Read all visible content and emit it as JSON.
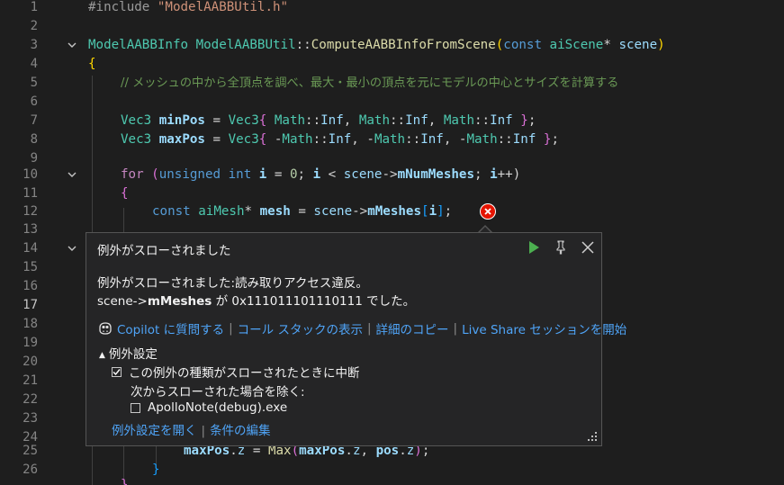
{
  "editor": {
    "active_line": 17,
    "lines": [
      {
        "n": "1"
      },
      {
        "n": "2"
      },
      {
        "n": "3"
      },
      {
        "n": "4"
      },
      {
        "n": "5"
      },
      {
        "n": "6"
      },
      {
        "n": "7"
      },
      {
        "n": "8"
      },
      {
        "n": "9"
      },
      {
        "n": "10"
      },
      {
        "n": "11"
      },
      {
        "n": "12"
      },
      {
        "n": "13"
      },
      {
        "n": "14"
      },
      {
        "n": "15"
      },
      {
        "n": "16"
      },
      {
        "n": "17"
      },
      {
        "n": "18"
      },
      {
        "n": "19"
      },
      {
        "n": "20"
      },
      {
        "n": "21"
      },
      {
        "n": "22"
      },
      {
        "n": "23"
      },
      {
        "n": "24"
      },
      {
        "n": "25"
      },
      {
        "n": "26"
      }
    ],
    "code": {
      "l1": [
        "#include ",
        "\"ModelAABBUtil.h\""
      ],
      "l3": [
        "ModelAABBInfo",
        " ",
        "ModelAABBUtil",
        "::",
        "ComputeAABBInfoFromScene",
        "(",
        "const",
        " ",
        "aiScene",
        "* ",
        "scene",
        ")"
      ],
      "l4": [
        "{"
      ],
      "l5": [
        "// メッシュの中から全頂点を調べ、最大・最小の頂点を元にモデルの中心とサイズを計算する"
      ],
      "l7": [
        "Vec3",
        " ",
        "minPos",
        " = ",
        "Vec3",
        "{ ",
        "Math",
        "::",
        "Inf",
        ", ",
        "Math",
        "::",
        "Inf",
        ", ",
        "Math",
        "::",
        "Inf",
        " }",
        ";"
      ],
      "l8": [
        "Vec3",
        " ",
        "maxPos",
        " = ",
        "Vec3",
        "{ ",
        "-",
        "Math",
        "::",
        "Inf",
        ", ",
        "-",
        "Math",
        "::",
        "Inf",
        ", ",
        "-",
        "Math",
        "::",
        "Inf",
        " }",
        ";"
      ],
      "l10": [
        "for",
        " (",
        "unsigned",
        " ",
        "int",
        " ",
        "i",
        " = ",
        "0",
        "; ",
        "i",
        " < ",
        "scene",
        "->",
        "mNumMeshes",
        "; ",
        "i",
        "++)"
      ],
      "l11": [
        "{"
      ],
      "l12": [
        "const",
        " ",
        "aiMesh",
        "* ",
        "mesh",
        " = ",
        "scene",
        "->",
        "mMeshes",
        "[",
        "i",
        "]",
        ";"
      ],
      "l25": [
        "maxPos",
        ".",
        "z",
        " = ",
        "Max",
        "(",
        "maxPos",
        ".",
        "z",
        ", ",
        "pos",
        ".",
        "z",
        ")",
        ";"
      ],
      "l26": [
        "}"
      ]
    }
  },
  "exception_popup": {
    "title": "例外がスローされました",
    "message_line1": "例外がスローされました:読み取りアクセス違反。",
    "message_line2_prefix": "scene->",
    "message_line2_bold": "mMeshes",
    "message_line2_suffix": " が 0x111011101110111 でした。",
    "actions": {
      "copilot": "Copilot に質問する",
      "call_stack": "コール スタックの表示",
      "copy_details": "詳細のコピー",
      "live_share": "Live Share セッションを開始"
    },
    "settings_header": "例外設定",
    "break_checkbox_label": "この例外の種類がスローされたときに中断",
    "break_checked": true,
    "except_label": "次からスローされた場合を除く:",
    "app_checkbox_label": "ApolloNote(debug).exe",
    "app_checked": false,
    "open_settings_link": "例外設定を開く",
    "edit_conditions_link": "条件の編集",
    "icons": {
      "continue": "play-icon",
      "pin": "pin-icon",
      "close": "close-icon"
    }
  },
  "colors": {
    "background": "#1e1e1e",
    "popup_background": "#252526",
    "link": "#4fa4f7",
    "error": "#e51400",
    "continue_green": "#4caf50"
  }
}
